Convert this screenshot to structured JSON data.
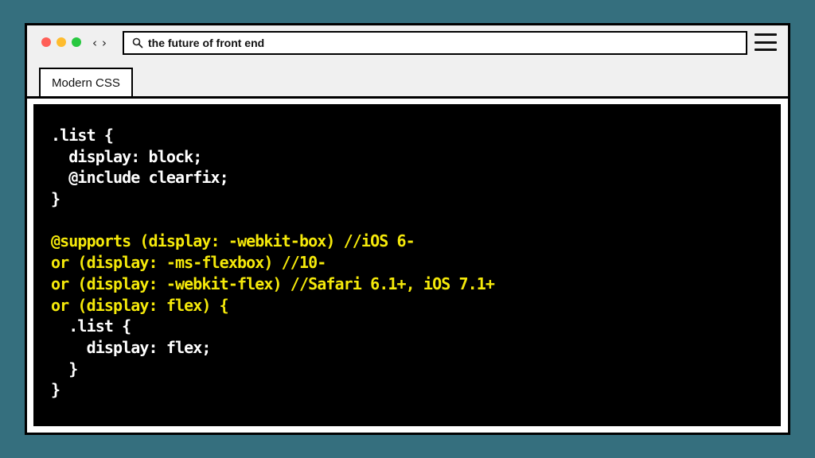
{
  "browser": {
    "window_controls": [
      {
        "name": "close",
        "color": "#ff5f57"
      },
      {
        "name": "minimize",
        "color": "#febc2e"
      },
      {
        "name": "maximize",
        "color": "#28c840"
      }
    ],
    "nav": {
      "back": "‹",
      "forward": "›"
    },
    "address_bar": {
      "icon": "search-icon",
      "value": "the future of front end"
    },
    "menu_icon": "hamburger-menu-icon"
  },
  "tabs": [
    {
      "label": "Modern CSS",
      "active": true
    }
  ],
  "code": {
    "colors": {
      "default": "#ffffff",
      "highlight": "#f5e90a",
      "background": "#000000"
    },
    "lines": [
      {
        "text": ".list {",
        "highlight": false
      },
      {
        "text": "  display: block;",
        "highlight": false
      },
      {
        "text": "  @include clearfix;",
        "highlight": false
      },
      {
        "text": "}",
        "highlight": false
      },
      {
        "text": "",
        "highlight": false
      },
      {
        "text": "@supports (display: -webkit-box) //iOS 6-",
        "highlight": true
      },
      {
        "text": "or (display: -ms-flexbox) //10-",
        "highlight": true
      },
      {
        "text": "or (display: -webkit-flex) //Safari 6.1+, iOS 7.1+",
        "highlight": true
      },
      {
        "text": "or (display: flex) {",
        "highlight": true
      },
      {
        "text": "  .list {",
        "highlight": false
      },
      {
        "text": "    display: flex;",
        "highlight": false
      },
      {
        "text": "  }",
        "highlight": false
      },
      {
        "text": "}",
        "highlight": false
      }
    ]
  }
}
